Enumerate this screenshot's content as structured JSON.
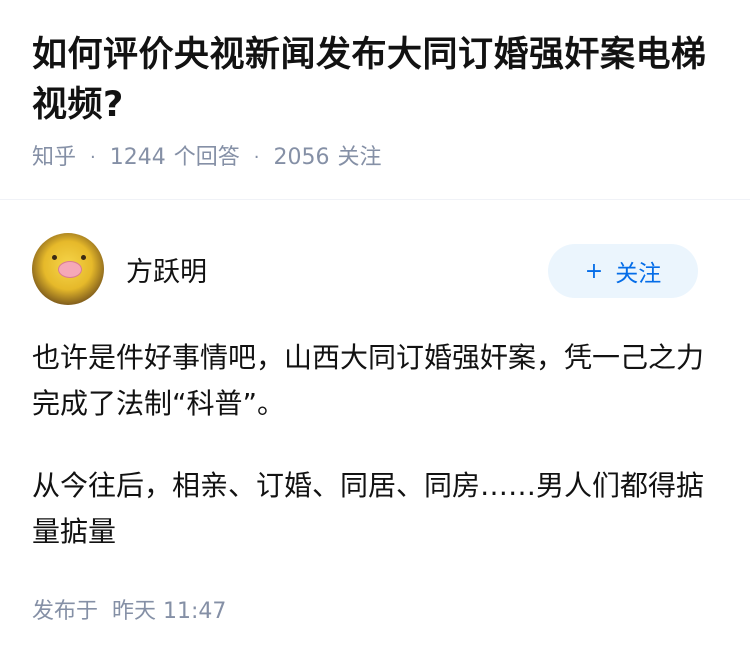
{
  "question": {
    "title": "如何评价央视新闻发布大同订婚强奸案电梯视频?",
    "source": "知乎",
    "answer_count": "1244",
    "answer_label": "个回答",
    "follow_count": "2056",
    "follow_label": "关注"
  },
  "answer": {
    "author_name": "方跃明",
    "follow_button": {
      "plus": "+",
      "label": "关注"
    },
    "paragraphs": [
      "也许是件好事情吧，山西大同订婚强奸案，凭一己之力完成了法制“科普”。",
      "从今往后，相亲、订婚、同居、同房……男人们都得掂量掂量"
    ],
    "published_label": "发布于",
    "published_time": "昨天 11:47"
  },
  "colors": {
    "accent": "#056de8",
    "accent_bg": "#ebf5fd",
    "meta_text": "#8590a6",
    "body_text": "#121212"
  }
}
